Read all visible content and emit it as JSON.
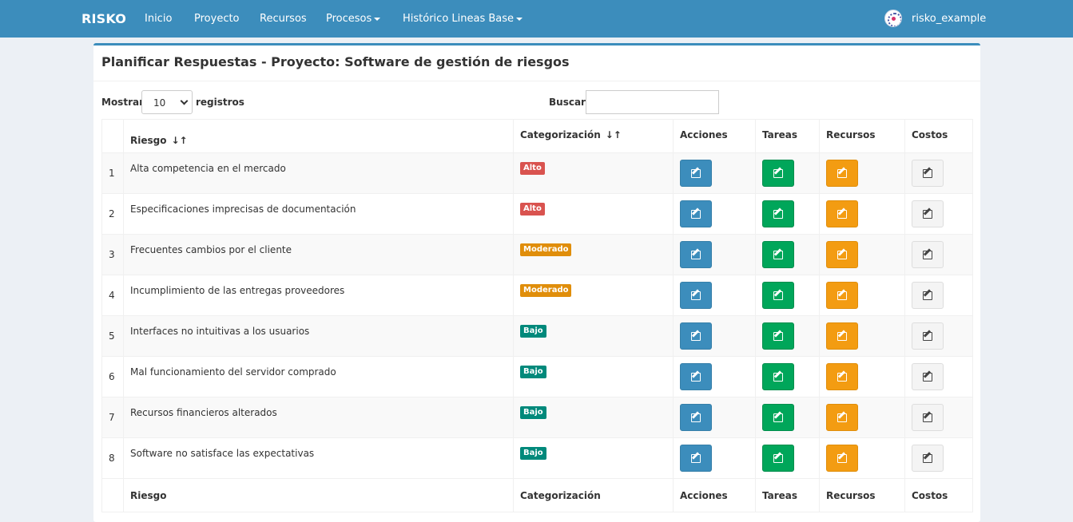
{
  "navbar": {
    "brand": "RISKO",
    "items": [
      {
        "label": "Inicio",
        "dropdown": false
      },
      {
        "label": "Proyecto",
        "dropdown": false
      },
      {
        "label": "Recursos",
        "dropdown": false
      },
      {
        "label": "Procesos",
        "dropdown": true
      },
      {
        "label": "Histórico Lineas Base",
        "dropdown": true
      }
    ],
    "username": "risko_example"
  },
  "page": {
    "title": "Planificar Respuestas - Proyecto: Software de gestión de riesgos"
  },
  "controls": {
    "length_label": "Mostrar",
    "length_value": "10",
    "length_suffix": "registros",
    "search_label": "Buscar:",
    "search_value": ""
  },
  "table": {
    "columns": [
      "",
      "Riesgo",
      "Categorización",
      "Acciones",
      "Tareas",
      "Recursos",
      "Costos"
    ],
    "footer": [
      "",
      "Riesgo",
      "Categorización",
      "Acciones",
      "Tareas",
      "Recursos",
      "Costos"
    ],
    "rows": [
      {
        "num": "1",
        "riesgo": "Alta competencia en el mercado",
        "categoria": "Alto"
      },
      {
        "num": "2",
        "riesgo": "Especificaciones imprecisas de documentación",
        "categoria": "Alto"
      },
      {
        "num": "3",
        "riesgo": "Frecuentes cambios por el cliente",
        "categoria": "Moderado"
      },
      {
        "num": "4",
        "riesgo": "Incumplimiento de las entregas proveedores",
        "categoria": "Moderado"
      },
      {
        "num": "5",
        "riesgo": "Interfaces no intuitivas a los usuarios",
        "categoria": "Bajo"
      },
      {
        "num": "6",
        "riesgo": "Mal funcionamiento del servidor comprado",
        "categoria": "Bajo"
      },
      {
        "num": "7",
        "riesgo": "Recursos financieros alterados",
        "categoria": "Bajo"
      },
      {
        "num": "8",
        "riesgo": "Software no satisface las expectativas",
        "categoria": "Bajo"
      }
    ]
  },
  "colors": {
    "primary": "#3c8dbc",
    "alto": "#d9534f",
    "moderado": "#e08e0b",
    "bajo": "#00897b",
    "acciones_btn": "#3c8dbc",
    "tareas_btn": "#00a65a",
    "recursos_btn": "#f39c12",
    "costos_btn": "#f4f4f4"
  },
  "icons": {
    "sort": "sort-icon",
    "edit": "edit-icon",
    "caret": "caret-down-icon"
  }
}
